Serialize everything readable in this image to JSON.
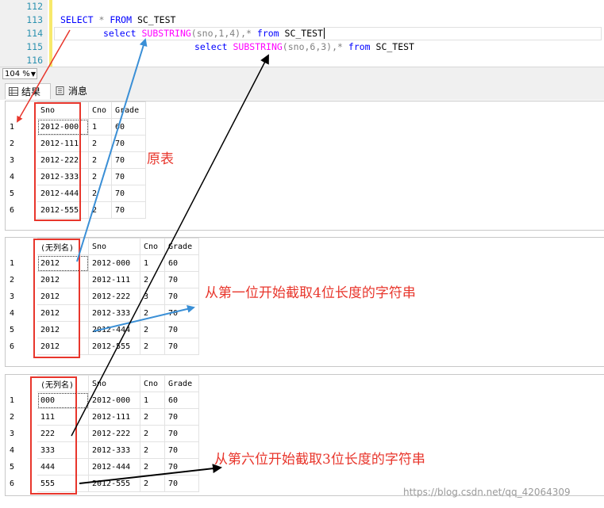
{
  "editor": {
    "line_numbers": [
      "112",
      "113",
      "114",
      "115",
      "116"
    ],
    "line113": {
      "kw1": "SELECT",
      "rest1": " * ",
      "kw2": "FROM",
      "rest2": " SC_TEST"
    },
    "line114": {
      "kw1": "select",
      "fn": "SUBSTRING",
      "args": "(sno,1,4),* ",
      "kw2": "from",
      "rest": " SC_TEST"
    },
    "line115": {
      "kw1": "select",
      "fn": "SUBSTRING",
      "args": "(sno,6,3),* ",
      "kw2": "from",
      "rest": " SC_TEST"
    }
  },
  "zoom": {
    "value": "104 %"
  },
  "tabs": [
    {
      "label": "结果",
      "icon": "grid-icon"
    },
    {
      "label": "消息",
      "icon": "message-icon"
    }
  ],
  "grids": [
    {
      "columns": [
        "Sno",
        "Cno",
        "Grade"
      ],
      "rows": [
        {
          "n": "1",
          "cells": [
            "2012-000",
            "1",
            "60"
          ]
        },
        {
          "n": "2",
          "cells": [
            "2012-111",
            "2",
            "70"
          ]
        },
        {
          "n": "3",
          "cells": [
            "2012-222",
            "2",
            "70"
          ]
        },
        {
          "n": "4",
          "cells": [
            "2012-333",
            "2",
            "70"
          ]
        },
        {
          "n": "5",
          "cells": [
            "2012-444",
            "2",
            "70"
          ]
        },
        {
          "n": "6",
          "cells": [
            "2012-555",
            "2",
            "70"
          ]
        }
      ]
    },
    {
      "columns": [
        "(无列名)",
        "Sno",
        "Cno",
        "Grade"
      ],
      "rows": [
        {
          "n": "1",
          "cells": [
            "2012",
            "2012-000",
            "1",
            "60"
          ]
        },
        {
          "n": "2",
          "cells": [
            "2012",
            "2012-111",
            "2",
            "70"
          ]
        },
        {
          "n": "3",
          "cells": [
            "2012",
            "2012-222",
            "3",
            "70"
          ]
        },
        {
          "n": "4",
          "cells": [
            "2012",
            "2012-333",
            "2",
            "70"
          ]
        },
        {
          "n": "5",
          "cells": [
            "2012",
            "2012-444",
            "2",
            "70"
          ]
        },
        {
          "n": "6",
          "cells": [
            "2012",
            "2012-555",
            "2",
            "70"
          ]
        }
      ]
    },
    {
      "columns": [
        "(无列名)",
        "Sno",
        "Cno",
        "Grade"
      ],
      "rows": [
        {
          "n": "1",
          "cells": [
            "000",
            "2012-000",
            "1",
            "60"
          ]
        },
        {
          "n": "2",
          "cells": [
            "111",
            "2012-111",
            "2",
            "70"
          ]
        },
        {
          "n": "3",
          "cells": [
            "222",
            "2012-222",
            "2",
            "70"
          ]
        },
        {
          "n": "4",
          "cells": [
            "333",
            "2012-333",
            "2",
            "70"
          ]
        },
        {
          "n": "5",
          "cells": [
            "444",
            "2012-444",
            "2",
            "70"
          ]
        },
        {
          "n": "6",
          "cells": [
            "555",
            "2012-555",
            "2",
            "70"
          ]
        }
      ]
    }
  ],
  "annotations": {
    "original": "原表",
    "first": "从第一位开始截取4位长度的字符串",
    "sixth": "从第六位开始截取3位长度的字符串"
  },
  "watermark": "https://blog.csdn.net/qq_42064309",
  "colors": {
    "annotation_red": "#e8362c",
    "arrow_blue": "#3a8fd6",
    "arrow_black": "#000000",
    "keyword_blue": "#0000ff",
    "function_pink": "#ff00ff"
  }
}
